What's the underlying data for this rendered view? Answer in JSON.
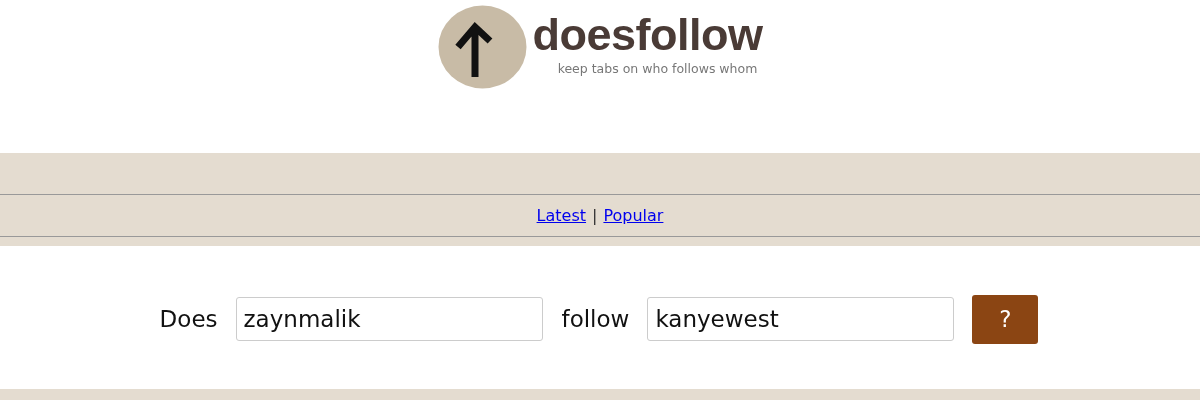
{
  "header": {
    "title": "doesfollow",
    "tagline": "keep tabs on who follows whom"
  },
  "nav": {
    "links": [
      {
        "label": "Latest"
      },
      {
        "label": "Popular"
      }
    ],
    "separator": "|"
  },
  "query": {
    "label_1": "Does",
    "field_1": "zaynmalik",
    "label_2": "follow",
    "field_2": "kanyewest",
    "button": "?"
  }
}
